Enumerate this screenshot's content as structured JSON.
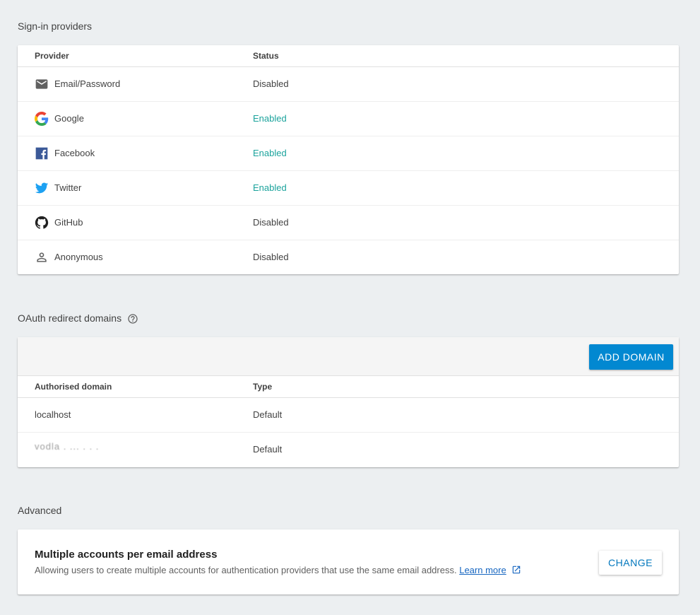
{
  "sections": {
    "providers_title": "Sign-in providers",
    "oauth_title": "OAuth redirect domains",
    "advanced_title": "Advanced"
  },
  "providers": {
    "col_provider": "Provider",
    "col_status": "Status",
    "rows": [
      {
        "name": "Email/Password",
        "status": "Disabled",
        "icon": "mail-icon"
      },
      {
        "name": "Google",
        "status": "Enabled",
        "icon": "google-icon"
      },
      {
        "name": "Facebook",
        "status": "Enabled",
        "icon": "facebook-icon"
      },
      {
        "name": "Twitter",
        "status": "Enabled",
        "icon": "twitter-icon"
      },
      {
        "name": "GitHub",
        "status": "Disabled",
        "icon": "github-icon"
      },
      {
        "name": "Anonymous",
        "status": "Disabled",
        "icon": "person-icon"
      }
    ]
  },
  "oauth": {
    "add_domain_label": "ADD DOMAIN",
    "col_domain": "Authorised domain",
    "col_type": "Type",
    "rows": [
      {
        "domain": "localhost",
        "type": "Default"
      },
      {
        "domain": "vodla . ... . . .",
        "type": "Default"
      }
    ]
  },
  "advanced": {
    "title": "Multiple accounts per email address",
    "description": "Allowing users to create multiple accounts for authentication providers that use the same email address.",
    "learn_more": "Learn more",
    "change_label": "CHANGE"
  },
  "colors": {
    "enabled": "#1ba39c",
    "primary_button": "#0288d1",
    "background": "#eceff1"
  }
}
